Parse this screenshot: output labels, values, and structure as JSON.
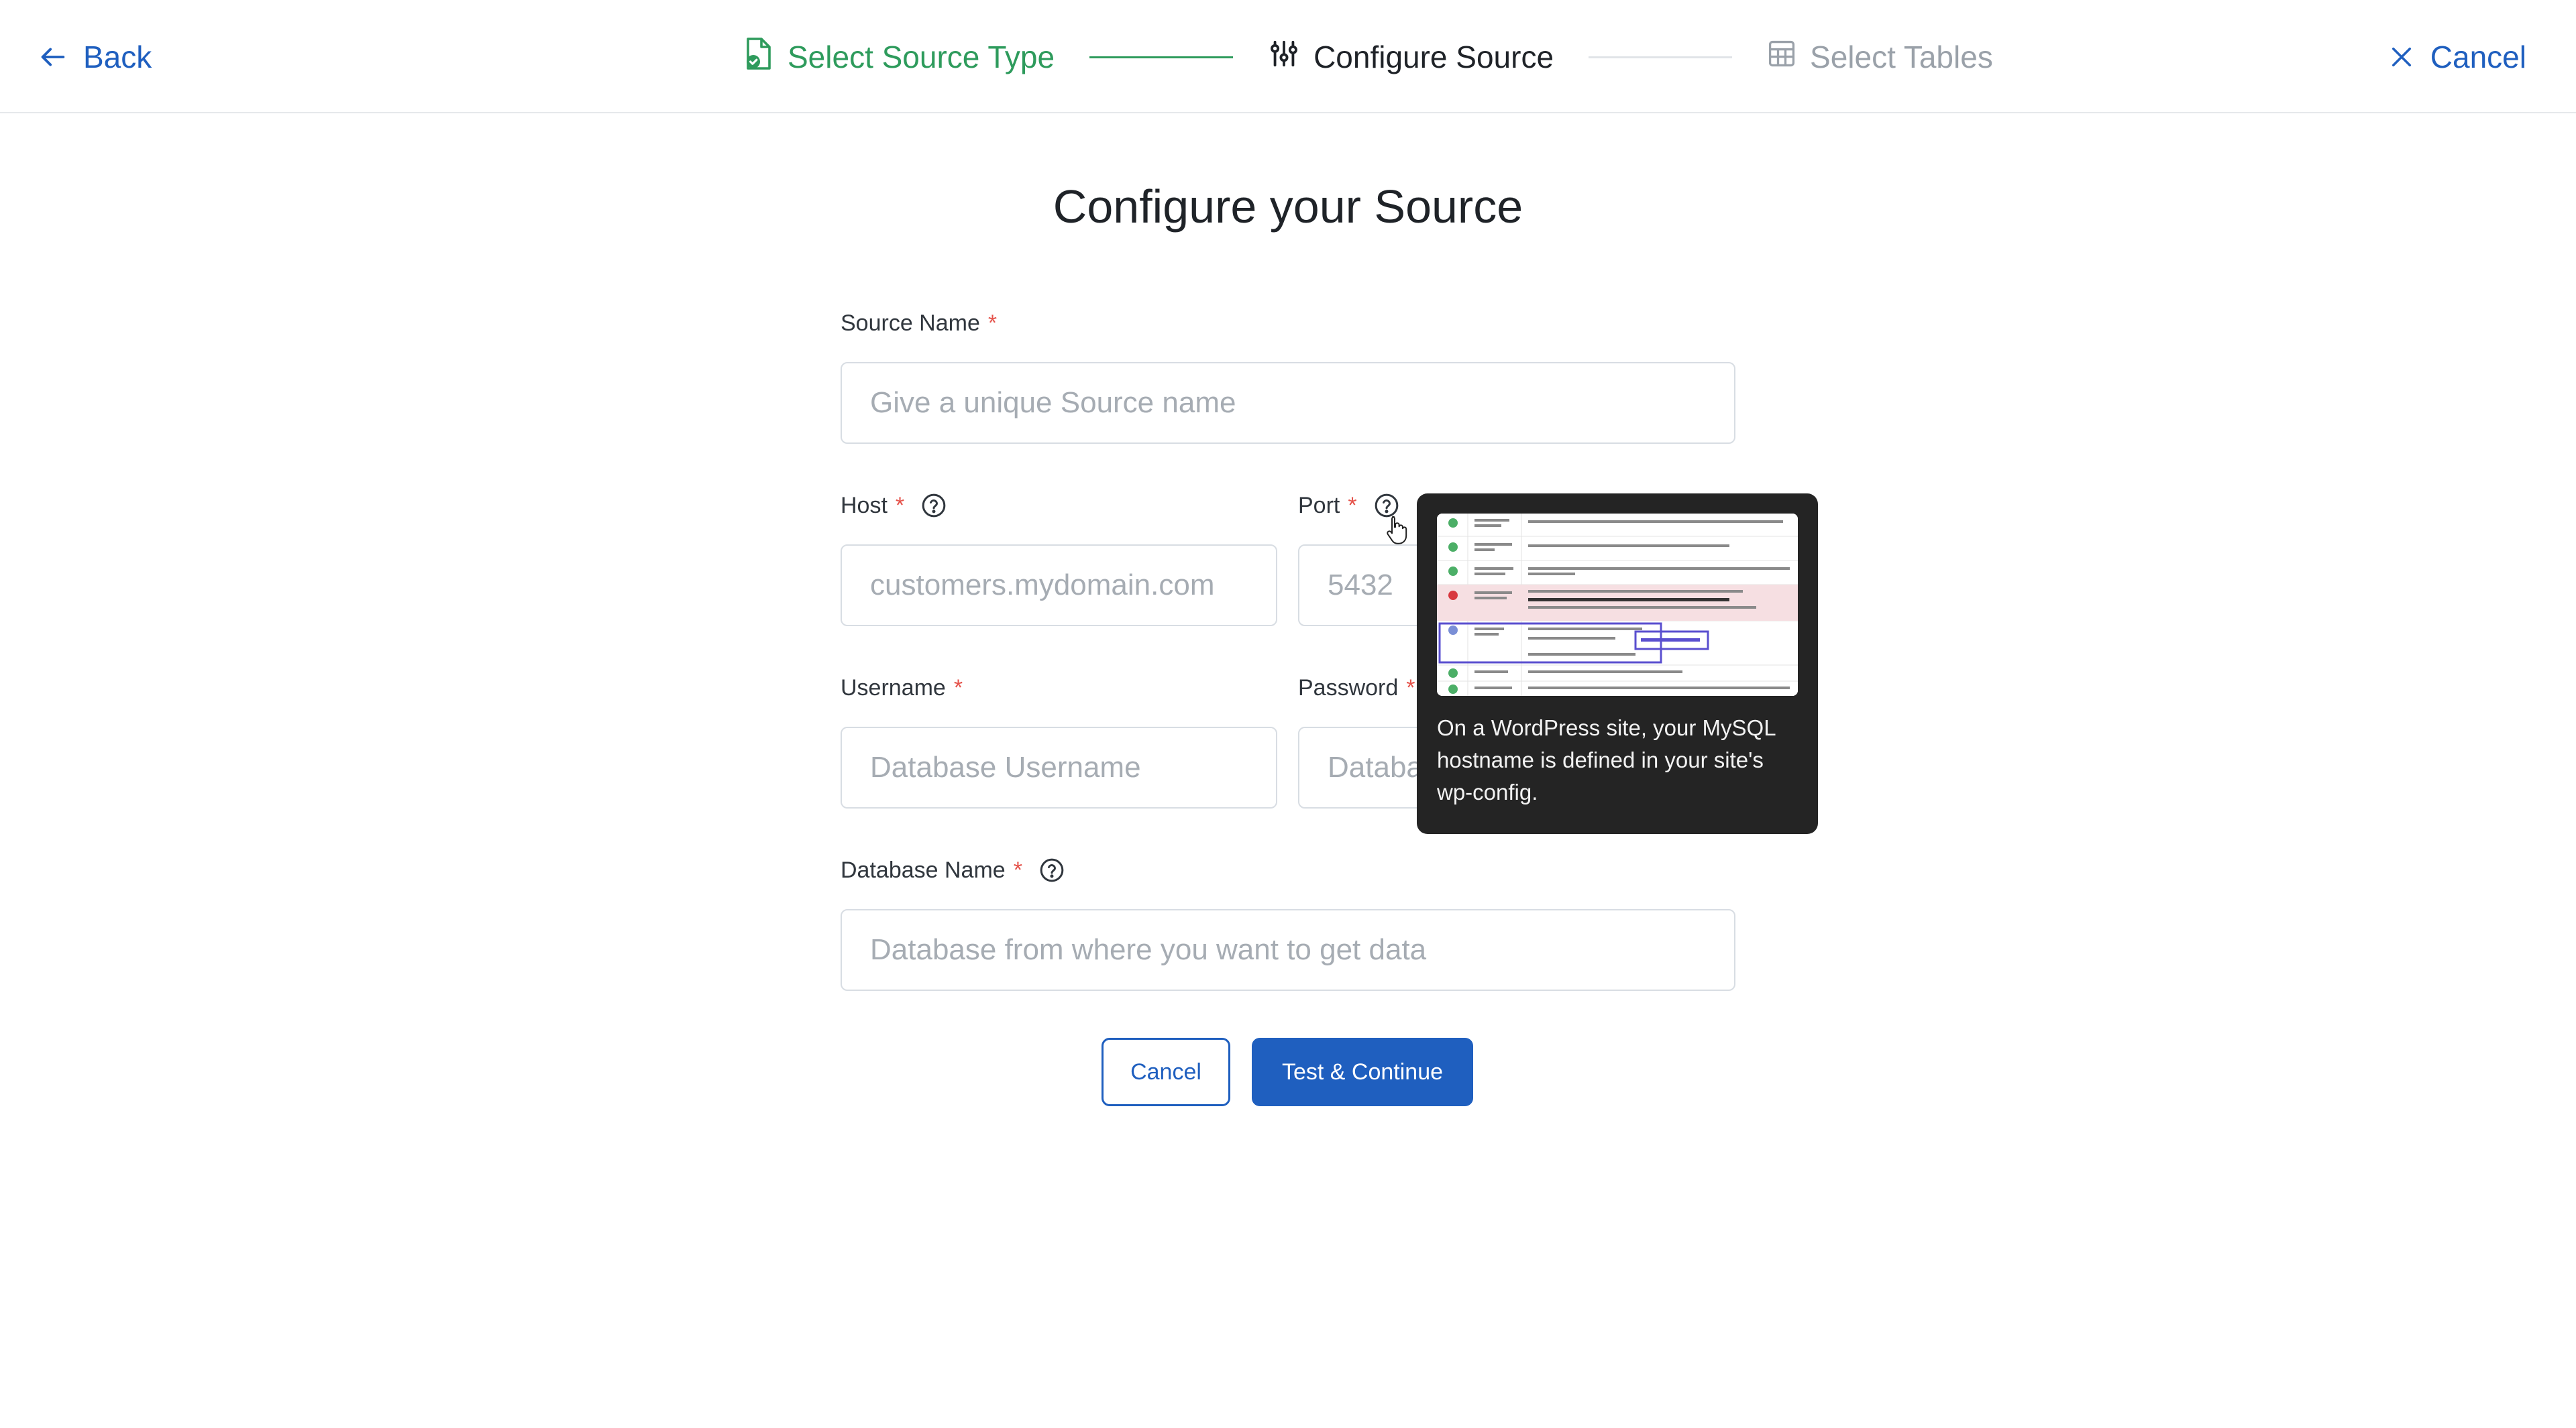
{
  "header": {
    "back_label": "Back",
    "cancel_label": "Cancel",
    "steps": [
      {
        "label": "Select Source Type",
        "state": "done"
      },
      {
        "label": "Configure Source",
        "state": "current"
      },
      {
        "label": "Select Tables",
        "state": "todo"
      }
    ]
  },
  "form": {
    "title": "Configure your Source",
    "required_mark": "*",
    "source_name": {
      "label": "Source Name",
      "placeholder": "Give a unique Source name",
      "value": ""
    },
    "host": {
      "label": "Host",
      "placeholder": "customers.mydomain.com",
      "value": ""
    },
    "port": {
      "label": "Port",
      "placeholder": "5432",
      "value": ""
    },
    "username": {
      "label": "Username",
      "placeholder": "Database Username",
      "value": ""
    },
    "password": {
      "label": "Password",
      "placeholder": "Database Password",
      "value": ""
    },
    "database_name": {
      "label": "Database Name",
      "placeholder": "Database from where you want to get data",
      "value": ""
    },
    "cancel_label": "Cancel",
    "submit_label": "Test & Continue"
  },
  "tooltip": {
    "text": "On a WordPress site, your MySQL hostname is defined in your site's wp-config."
  },
  "colors": {
    "accent": "#1f5fbf",
    "step_done": "#2e9b5c",
    "required": "#e5534b",
    "tooltip_bg": "#242424"
  },
  "icons": {
    "back": "arrow-left-icon",
    "cancel": "close-icon",
    "step_done": "file-check-icon",
    "step_current": "sliders-icon",
    "step_todo": "table-grid-icon",
    "help": "question-circle-icon",
    "cursor": "hand-pointer-icon"
  }
}
